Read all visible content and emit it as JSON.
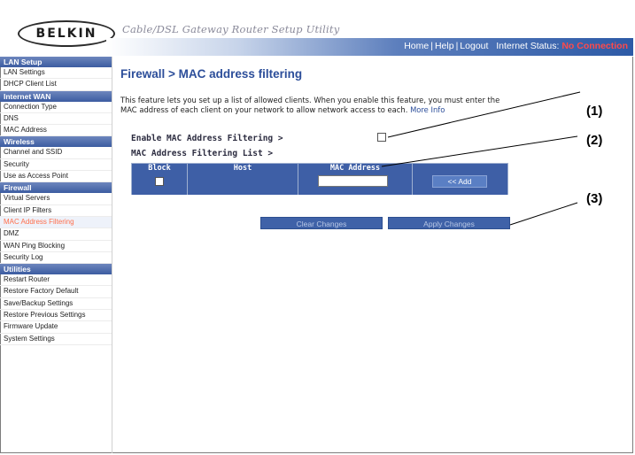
{
  "header": {
    "logo": "BELKIN",
    "tagline": "Cable/DSL Gateway Router Setup Utility",
    "links": [
      "Home",
      "Help",
      "Logout"
    ],
    "internet_status_label": "Internet Status:",
    "internet_status_value": "No Connection"
  },
  "sidebar": {
    "sections": [
      {
        "title": "LAN Setup",
        "items": [
          "LAN Settings",
          "DHCP Client List"
        ]
      },
      {
        "title": "Internet WAN",
        "items": [
          "Connection Type",
          "DNS",
          "MAC Address"
        ]
      },
      {
        "title": "Wireless",
        "items": [
          "Channel and SSID",
          "Security",
          "Use as Access Point"
        ]
      },
      {
        "title": "Firewall",
        "items": [
          "Virtual Servers",
          "Client IP Filters",
          "MAC Address Filtering",
          "DMZ",
          "WAN Ping Blocking",
          "Security Log"
        ]
      },
      {
        "title": "Utilities",
        "items": [
          "Restart Router",
          "Restore Factory Default",
          "Save/Backup Settings",
          "Restore Previous Settings",
          "Firmware Update",
          "System Settings"
        ]
      }
    ],
    "active_item": "MAC Address Filtering"
  },
  "main": {
    "title": "Firewall > MAC address filtering",
    "description_line1": "This feature lets you set up a list of allowed clients. When you enable this feature, you must enter the",
    "description_line2": "MAC address of each client on your network to allow network access to each.",
    "more_info": "More Info",
    "enable_label": "Enable MAC Address Filtering >",
    "list_label": "MAC Address Filtering List >",
    "table_headers": [
      "Block",
      "Host",
      "MAC Address"
    ],
    "add_button": "<< Add",
    "clear_button": "Clear Changes",
    "apply_button": "Apply Changes"
  },
  "callouts": [
    "(1)",
    "(2)",
    "(3)"
  ],
  "colors": {
    "accent": "#2c4e9a",
    "status_red": "#ff4a4a",
    "active_item": "#ff6e4a"
  }
}
